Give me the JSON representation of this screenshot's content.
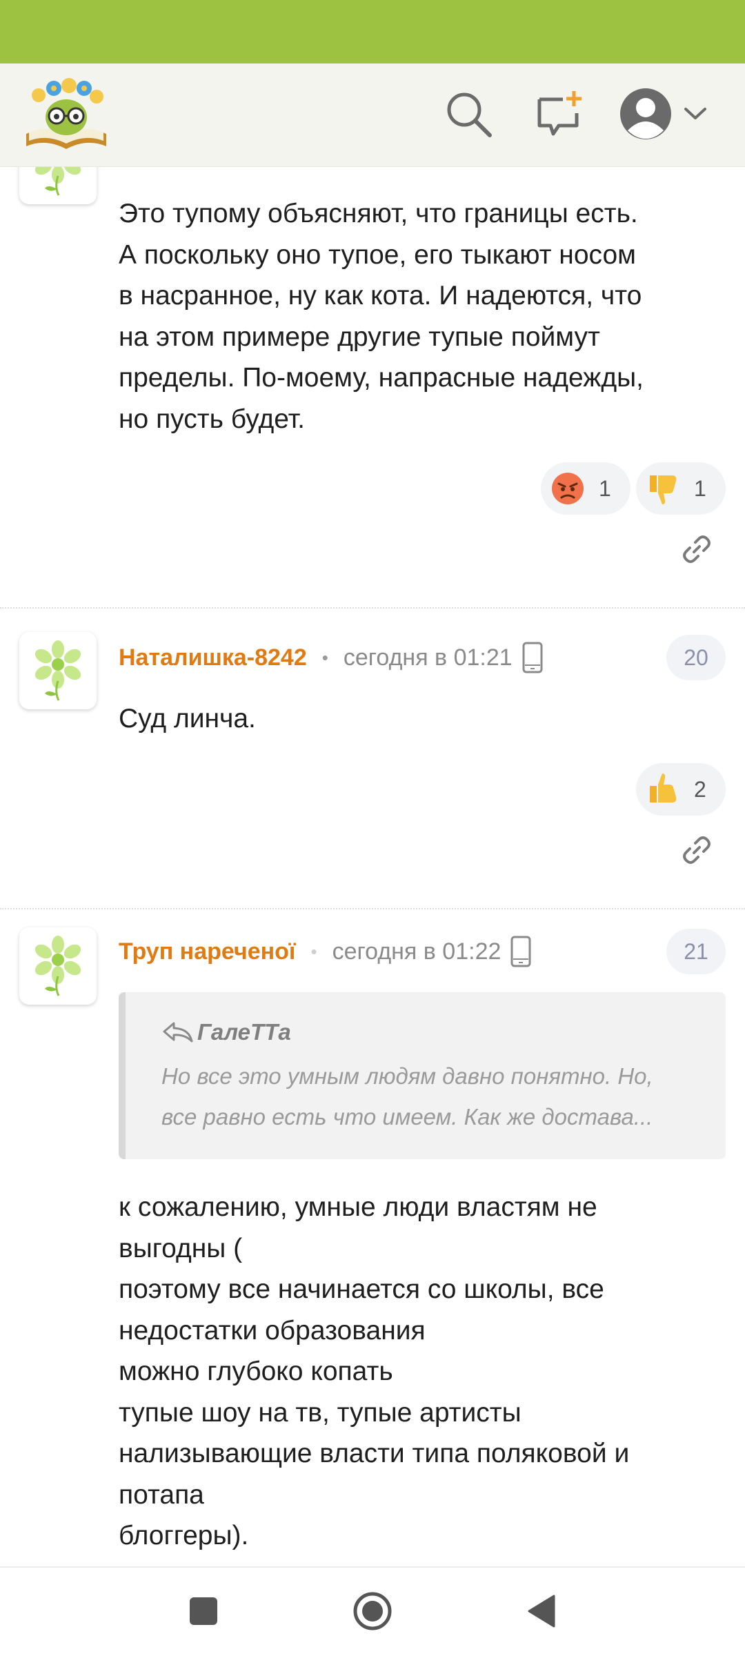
{
  "status_bar": {
    "color": "#9dc241"
  },
  "header": {
    "logo_icon": "flower-crown-book-logo",
    "search_icon": "search-icon",
    "new_post_icon": "new-message-icon",
    "profile_icon": "user-avatar-icon",
    "profile_menu_icon": "chevron-down-icon"
  },
  "colors": {
    "author": "#e07b12",
    "accent_green": "#9dc241"
  },
  "comments": [
    {
      "text_lines": [
        "Это тупому объясняют, что границы есть.",
        "А поскольку оно тупое, его тыкают носом",
        "в насранное, ну как кота. И надеются, что",
        "на этом примере другие тупые поймут",
        "пределы. По-моему, напрасные надежды,",
        "но пусть будет."
      ],
      "reactions": [
        {
          "icon": "angry-face-emoji",
          "count": "1"
        },
        {
          "icon": "thumbs-down-emoji",
          "count": "1"
        }
      ]
    },
    {
      "author": "Наталишка-8242",
      "separator": "•",
      "time": "сегодня в 01:21",
      "device_icon": "mobile-phone-icon",
      "number": "20",
      "text_lines": [
        "Суд линча."
      ],
      "reactions": [
        {
          "icon": "thumbs-up-emoji",
          "count": "2"
        }
      ]
    },
    {
      "author": "Труп нареченої",
      "separator": "•",
      "time": "сегодня в 01:22",
      "device_icon": "mobile-phone-icon",
      "number": "21",
      "quote": {
        "author": "ГалеТТа",
        "lines": [
          "Но все это умным людям давно понятно. Но,",
          "все равно есть что имеем. Как же достава..."
        ]
      },
      "text_lines": [
        "к сожалению, умные люди властям не",
        "выгодны (",
        "поэтому все начинается со школы, все",
        "недостатки образования",
        "можно глубоко копать",
        "тупые шоу на тв, тупые артисты",
        "нализывающие власти типа поляковой и",
        "потапа",
        "блоггеры)."
      ]
    }
  ],
  "nav_bar": {
    "recents_icon": "square-recents-icon",
    "home_icon": "circle-home-icon",
    "back_icon": "triangle-back-icon"
  }
}
